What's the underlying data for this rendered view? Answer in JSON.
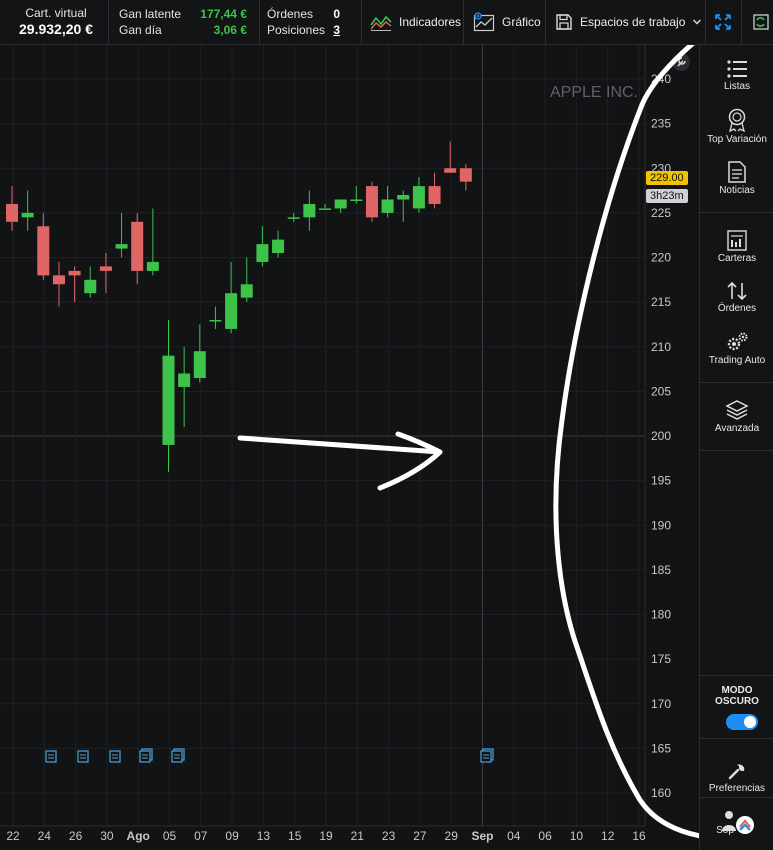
{
  "account": {
    "virtual_label": "Cart. virtual",
    "virtual_value": "29.932,20 €",
    "unrealized_label": "Gan latente",
    "unrealized_value": "177,44 €",
    "day_label": "Gan día",
    "day_value": "3,06 €",
    "orders_label": "Órdenes",
    "orders_value": "0",
    "positions_label": "Posiciones",
    "positions_value": "3"
  },
  "toolbar": {
    "indicators_label": "Indicadores",
    "chart_label": "Gráfico",
    "workspaces_label": "Espacios de trabajo"
  },
  "chart": {
    "symbol_label": "APPLE INC.",
    "last_price_label": "229.00",
    "countdown_label": "3h23m"
  },
  "sidebar": {
    "items": [
      {
        "label": "Listas",
        "icon": "list-icon"
      },
      {
        "label": "Top Variación",
        "icon": "award-icon"
      },
      {
        "label": "Noticias",
        "icon": "news-icon"
      },
      {
        "label": "Carteras",
        "icon": "portfolio-icon"
      },
      {
        "label": "Órdenes",
        "icon": "orders-icon"
      },
      {
        "label": "Trading Auto",
        "icon": "gears-icon"
      },
      {
        "label": "Avanzada",
        "icon": "layers-icon"
      }
    ],
    "dark_mode_label": "MODO OSCURO",
    "dark_mode_on": true,
    "preferences_label": "Preferencias",
    "support_label": "Sop"
  },
  "colors": {
    "up": "#3ec34a",
    "down": "#e06666",
    "accent": "#1f8ef1",
    "price_tag": "#f2c200"
  },
  "chart_data": {
    "type": "candlestick",
    "y_ticks": [
      160,
      165,
      170,
      175,
      180,
      185,
      190,
      195,
      200,
      205,
      210,
      215,
      220,
      225,
      230,
      235,
      240
    ],
    "ylim": [
      157,
      242
    ],
    "x_tick_labels": [
      "22",
      "24",
      "26",
      "30",
      "Ago",
      "05",
      "07",
      "09",
      "13",
      "15",
      "19",
      "21",
      "23",
      "27",
      "29",
      "Sep",
      "04",
      "06",
      "10",
      "12",
      "16"
    ],
    "candles": [
      {
        "o": 226.0,
        "h": 228.0,
        "l": 223.0,
        "c": 224.0
      },
      {
        "o": 224.5,
        "h": 227.5,
        "l": 223.0,
        "c": 225.0
      },
      {
        "o": 223.5,
        "h": 225.0,
        "l": 217.5,
        "c": 218.0
      },
      {
        "o": 218.0,
        "h": 219.5,
        "l": 214.5,
        "c": 217.0
      },
      {
        "o": 218.5,
        "h": 219.0,
        "l": 215.0,
        "c": 218.0
      },
      {
        "o": 216.0,
        "h": 219.0,
        "l": 215.5,
        "c": 217.5
      },
      {
        "o": 219.0,
        "h": 220.5,
        "l": 216.0,
        "c": 218.5
      },
      {
        "o": 221.0,
        "h": 225.0,
        "l": 220.0,
        "c": 221.5
      },
      {
        "o": 224.0,
        "h": 225.0,
        "l": 217.0,
        "c": 218.5
      },
      {
        "o": 218.5,
        "h": 225.5,
        "l": 218.0,
        "c": 219.5
      },
      {
        "o": 199.0,
        "h": 213.0,
        "l": 196.0,
        "c": 209.0
      },
      {
        "o": 205.5,
        "h": 210.0,
        "l": 201.0,
        "c": 207.0
      },
      {
        "o": 206.5,
        "h": 212.5,
        "l": 206.0,
        "c": 209.5
      },
      {
        "o": 213.0,
        "h": 214.5,
        "l": 212.0,
        "c": 213.0
      },
      {
        "o": 212.0,
        "h": 219.5,
        "l": 211.5,
        "c": 216.0
      },
      {
        "o": 215.5,
        "h": 220.0,
        "l": 215.0,
        "c": 217.0
      },
      {
        "o": 219.5,
        "h": 223.5,
        "l": 219.0,
        "c": 221.5
      },
      {
        "o": 220.5,
        "h": 223.0,
        "l": 220.0,
        "c": 222.0
      },
      {
        "o": 224.5,
        "h": 225.0,
        "l": 224.0,
        "c": 224.5
      },
      {
        "o": 224.5,
        "h": 227.5,
        "l": 223.0,
        "c": 226.0
      },
      {
        "o": 225.5,
        "h": 226.0,
        "l": 225.5,
        "c": 225.5
      },
      {
        "o": 225.5,
        "h": 226.5,
        "l": 225.0,
        "c": 226.5
      },
      {
        "o": 226.5,
        "h": 228.0,
        "l": 226.0,
        "c": 226.5
      },
      {
        "o": 228.0,
        "h": 228.5,
        "l": 224.0,
        "c": 224.5
      },
      {
        "o": 225.0,
        "h": 228.0,
        "l": 224.5,
        "c": 226.5
      },
      {
        "o": 226.5,
        "h": 227.5,
        "l": 224.0,
        "c": 227.0
      },
      {
        "o": 225.5,
        "h": 229.0,
        "l": 225.0,
        "c": 228.0
      },
      {
        "o": 228.0,
        "h": 229.5,
        "l": 225.5,
        "c": 226.0
      },
      {
        "o": 230.0,
        "h": 233.0,
        "l": 229.5,
        "c": 229.5
      },
      {
        "o": 230.0,
        "h": 230.5,
        "l": 227.5,
        "c": 228.5
      }
    ]
  }
}
